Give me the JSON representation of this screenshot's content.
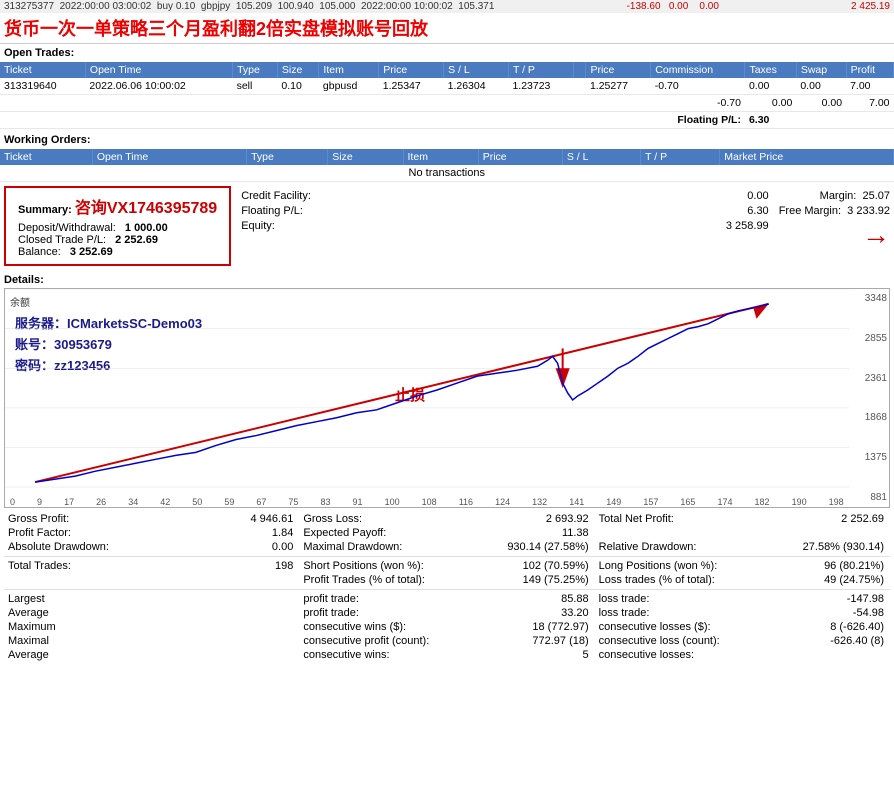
{
  "titleBar": {
    "prevData": "313275377  2022:00:00 03:00:02  buy 0.10  gbpjpy  105.209  100.940  105.000  2022:00:00 10:00:02  105.371",
    "closedAmt": "2 425.19",
    "title": "货币一次一单策略三个月盈利翻2倍实盘模拟账号回放"
  },
  "openTrades": {
    "sectionLabel": "Open Trades:",
    "columns": [
      "Ticket",
      "Open Time",
      "Type",
      "Size",
      "Item",
      "Price",
      "S / L",
      "T / P",
      "",
      "Price",
      "Commission",
      "Taxes",
      "Swap",
      "Profit"
    ],
    "rows": [
      {
        "ticket": "313319640",
        "openTime": "2022.06.06 10:00:02",
        "type": "sell",
        "size": "0.10",
        "item": "gbpusd",
        "price": "1.25347",
        "sl": "1.26304",
        "tp": "1.23723",
        "price2": "1.25277",
        "commission": "-0.70",
        "taxes": "0.00",
        "swap": "0.00",
        "profit": "7.00"
      }
    ],
    "floatingRow": {
      "commission": "-0.70",
      "taxes": "0.00",
      "swap": "0.00",
      "profit": "7.00"
    },
    "floatingPL": {
      "label": "Floating P/L:",
      "value": "6.30"
    }
  },
  "workingOrders": {
    "sectionLabel": "Working Orders:",
    "columns": [
      "Ticket",
      "Open Time",
      "Type",
      "Size",
      "Item",
      "Price",
      "S / L",
      "T / P",
      "Market Price"
    ],
    "noTransactions": "No transactions"
  },
  "summary": {
    "sectionLabel": "Summary:",
    "contact": "咨询VX1746395789",
    "depositLabel": "Deposit/Withdrawal:",
    "depositValue": "1 000.00",
    "closedTradePLLabel": "Closed Trade P/L:",
    "closedTradePLValue": "2 252.69",
    "balanceLabel": "Balance:",
    "balanceValue": "3 252.69",
    "creditFacilityLabel": "Credit Facility:",
    "creditFacilityValue": "0.00",
    "floatingPLLabel": "Floating P/L:",
    "floatingPLValue": "6.30",
    "equityLabel": "Equity:",
    "equityValue": "3 258.99",
    "marginLabel": "Margin:",
    "marginValue": "25.07",
    "freeMarginLabel": "Free Margin:",
    "freeMarginValue": "3 233.92"
  },
  "details": {
    "sectionLabel": "Details:",
    "chartLabels": {
      "yAxisValues": [
        "3348",
        "2855",
        "2361",
        "1868",
        "1375",
        "881"
      ],
      "xAxisValues": [
        "0",
        "9",
        "17",
        "26",
        "34",
        "42",
        "50",
        "59",
        "67",
        "75",
        "83",
        "91",
        "100",
        "108",
        "116",
        "124",
        "132",
        "141",
        "149",
        "157",
        "165",
        "174",
        "182",
        "190",
        "198"
      ],
      "yAxisLabel": "余额",
      "serverText": "服务器：ICMarketsSC-Demo03",
      "accountText": "账号：30953679",
      "passwordText": "密码：zz123456",
      "stopLossText": "止损"
    }
  },
  "statsBottom": {
    "grossProfitLabel": "Gross Profit:",
    "grossProfitValue": "4 946.61",
    "grossLossLabel": "Gross Loss:",
    "grossLossValue": "2 693.92",
    "totalNetProfitLabel": "Total Net Profit:",
    "totalNetProfitValue": "2 252.69",
    "profitFactorLabel": "Profit Factor:",
    "profitFactorValue": "1.84",
    "expectedPayoffLabel": "Expected Payoff:",
    "expectedPayoffValue": "11.38",
    "absoluteDrawdownLabel": "Absolute Drawdown:",
    "absoluteDrawdownValue": "0.00",
    "maxDrawdownLabel": "Maximal Drawdown:",
    "maxDrawdownValue": "930.14 (27.58%)",
    "relativeDrawdownLabel": "Relative Drawdown:",
    "relativeDrawdownValue": "27.58% (930.14)",
    "totalTradesLabel": "Total Trades:",
    "totalTradesValue": "198",
    "shortPositionsLabel": "Short Positions (won %):",
    "shortPositionsValue": "102 (70.59%)",
    "longPositionsLabel": "Long Positions (won %):",
    "longPositionsValue": "96 (80.21%)",
    "profitTradesLabel": "Profit Trades (% of total):",
    "profitTradesValue": "149 (75.25%)",
    "lossTradesLabel": "Loss trades (% of total):",
    "lossTradesValue": "49 (24.75%)",
    "largestLabel": "Largest",
    "largestProfitTradeLabel": "profit trade:",
    "largestProfitTradeValue": "85.88",
    "largestLossTradeLabel": "loss trade:",
    "largestLossTradeValue": "-147.98",
    "averageLabel": "Average",
    "averageProfitTradeLabel": "profit trade:",
    "averageProfitTradeValue": "33.20",
    "averageLossTradeLabel": "loss trade:",
    "averageLossTradeValue": "-54.98",
    "maximumLabel": "Maximum",
    "maxConsecWinsLabel": "consecutive wins ($):",
    "maxConsecWinsValue": "18 (772.97)",
    "maxConsecLossesLabel": "consecutive losses ($):",
    "maxConsecLossesValue": "8 (-626.40)",
    "maximalLabel": "Maximal",
    "maxConsecProfitLabel": "consecutive profit (count):",
    "maxConsecProfitValue": "772.97 (18)",
    "maxConsecLossLabel": "consecutive loss (count):",
    "maxConsecLossValue": "-626.40 (8)",
    "averageLabel2": "Average",
    "avgConsecWinsLabel": "consecutive wins:",
    "avgConsecWinsValue": "5",
    "avgConsecLossesLabel": "consecutive losses:",
    "avgConsecLossesValue": ""
  }
}
